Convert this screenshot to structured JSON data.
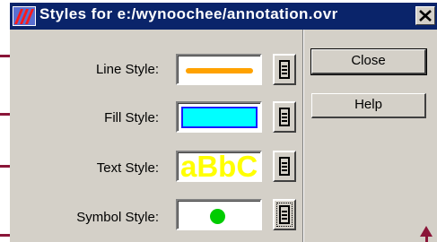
{
  "window": {
    "title": "Styles for e:/wynoochee/annotation.ovr",
    "app_icon": "styles-app-icon",
    "close_icon": "close-icon"
  },
  "rows": [
    {
      "label": "Line Style:",
      "preview": "line",
      "preview_color": "#ffa200"
    },
    {
      "label": "Fill Style:",
      "preview": "fill",
      "preview_color": "#00ffff"
    },
    {
      "label": "Text Style:",
      "preview": "text",
      "sample_text": "aBbC",
      "preview_color": "#ffff00"
    },
    {
      "label": "Symbol Style:",
      "preview": "symbol",
      "preview_color": "#00cc00"
    }
  ],
  "picker_icon": "style-picker-icon",
  "buttons": {
    "close_label": "Close",
    "help_label": "Help"
  },
  "annotation_color": "#8a1538"
}
